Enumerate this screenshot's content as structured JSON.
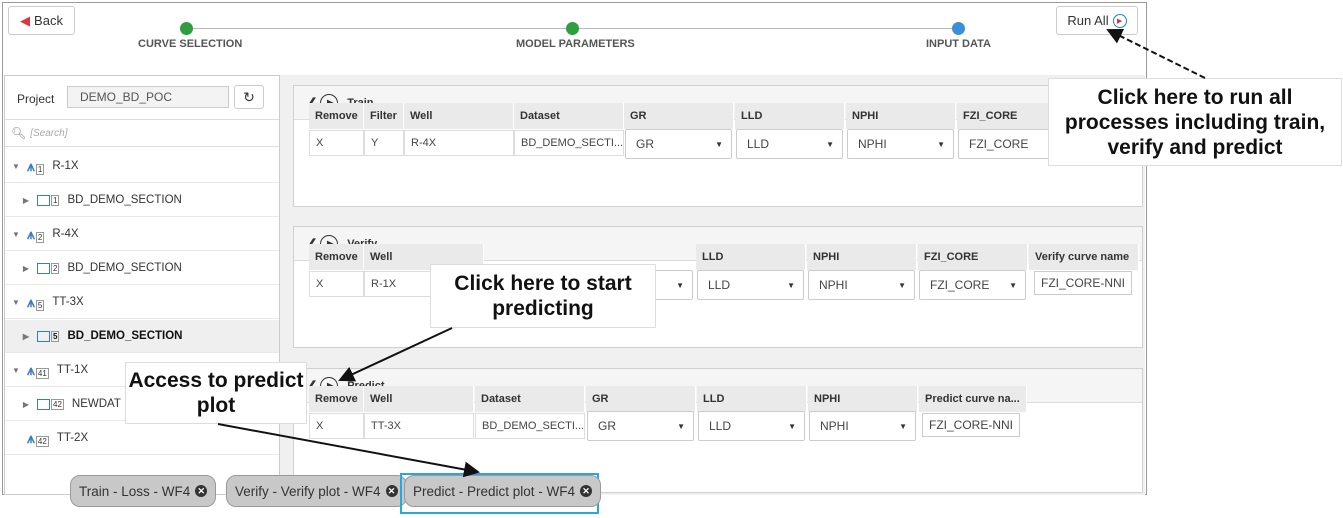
{
  "header": {
    "back_label": "Back",
    "run_all_label": "Run All",
    "steps": [
      {
        "label": "CURVE SELECTION",
        "color": "#2e9e3e"
      },
      {
        "label": "MODEL PARAMETERS",
        "color": "#2e9e3e"
      },
      {
        "label": "INPUT DATA",
        "color": "#3a8fd6"
      }
    ]
  },
  "project": {
    "label": "Project",
    "value": "DEMO_BD_POC",
    "search_placeholder": "[Search]"
  },
  "tree": [
    {
      "label": "R-1X",
      "badge": "1",
      "level": 0
    },
    {
      "label": "BD_DEMO_SECTION",
      "badge": "1",
      "level": 1
    },
    {
      "label": "R-4X",
      "badge": "2",
      "level": 0
    },
    {
      "label": "BD_DEMO_SECTION",
      "badge": "2",
      "level": 1
    },
    {
      "label": "TT-3X",
      "badge": "5",
      "level": 0
    },
    {
      "label": "BD_DEMO_SECTION",
      "badge": "5",
      "level": 1
    },
    {
      "label": "TT-1X",
      "badge": "41",
      "level": 0
    },
    {
      "label": "NEWDAT",
      "badge": "42",
      "level": 1
    },
    {
      "label": "TT-2X",
      "badge": "42",
      "level": 0
    }
  ],
  "train": {
    "title": "Train",
    "headers": [
      "Remove",
      "Filter",
      "Well",
      "Dataset",
      "GR",
      "LLD",
      "NPHI",
      "FZI_CORE"
    ],
    "row": {
      "remove": "X",
      "filter": "Y",
      "well": "R-4X",
      "dataset": "BD_DEMO_SECTI...",
      "gr": "GR",
      "lld": "LLD",
      "nphi": "NPHI",
      "fzi": "FZI_CORE"
    }
  },
  "verify": {
    "title": "Verify",
    "headers": [
      "Remove",
      "Well",
      "LLD",
      "NPHI",
      "FZI_CORE",
      "Verify curve name"
    ],
    "row": {
      "remove": "X",
      "well": "R-1X",
      "lld": "LLD",
      "nphi": "NPHI",
      "fzi": "FZI_CORE",
      "curve": "FZI_CORE-NNI"
    }
  },
  "predict": {
    "title": "Predict",
    "headers": [
      "Remove",
      "Well",
      "Dataset",
      "GR",
      "LLD",
      "NPHI",
      "Predict curve na..."
    ],
    "row": {
      "remove": "X",
      "well": "TT-3X",
      "dataset": "BD_DEMO_SECTI...",
      "gr": "GR",
      "lld": "LLD",
      "nphi": "NPHI",
      "curve": "FZI_CORE-NNI"
    }
  },
  "callouts": {
    "run_all": "Click here to run all processes including train, verify and predict",
    "predict": "Click here to start predicting",
    "plot": "Access to predict plot"
  },
  "tabs": [
    {
      "label": "Train - Loss - WF4"
    },
    {
      "label": "Verify - Verify plot - WF4"
    },
    {
      "label": "Predict - Predict plot - WF4"
    }
  ]
}
